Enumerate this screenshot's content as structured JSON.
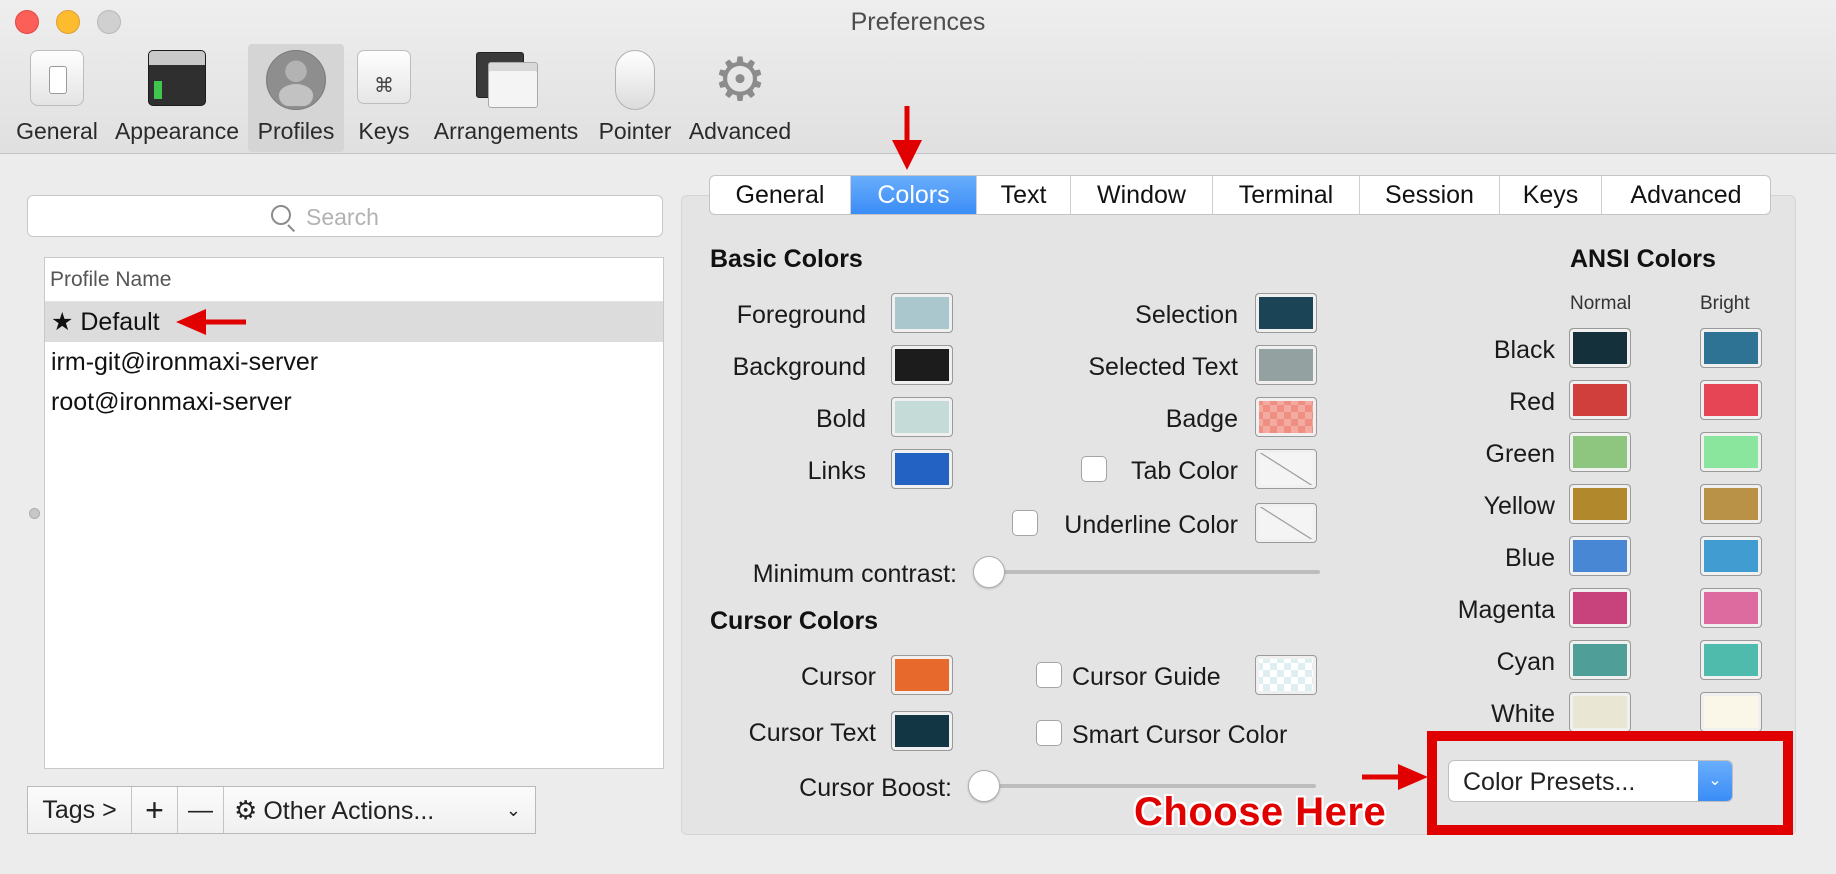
{
  "window": {
    "title": "Preferences"
  },
  "toolbar": {
    "items": [
      {
        "label": "General",
        "icon": "general-switch-icon"
      },
      {
        "label": "Appearance",
        "icon": "appearance-terminal-icon"
      },
      {
        "label": "Profiles",
        "icon": "profiles-user-icon",
        "selected": true
      },
      {
        "label": "Keys",
        "icon": "keys-command-icon"
      },
      {
        "label": "Arrangements",
        "icon": "arrangements-windows-icon"
      },
      {
        "label": "Pointer",
        "icon": "pointer-mouse-icon"
      },
      {
        "label": "Advanced",
        "icon": "advanced-gear-icon"
      }
    ],
    "keys_glyph": "⌘",
    "gear_glyph": "⚙"
  },
  "profiles": {
    "search_placeholder": "Search",
    "header": "Profile Name",
    "items": [
      {
        "name": "★ Default",
        "selected": true
      },
      {
        "name": "irm-git@ironmaxi-server"
      },
      {
        "name": "root@ironmaxi-server"
      }
    ],
    "tags_label": "Tags >",
    "add_label": "+",
    "remove_label": "—",
    "other_actions_label": "Other Actions...",
    "chevron": "⌄"
  },
  "tabs": [
    {
      "label": "General"
    },
    {
      "label": "Colors",
      "active": true
    },
    {
      "label": "Text"
    },
    {
      "label": "Window"
    },
    {
      "label": "Terminal"
    },
    {
      "label": "Session"
    },
    {
      "label": "Keys"
    },
    {
      "label": "Advanced"
    }
  ],
  "basic_colors": {
    "title": "Basic Colors",
    "foreground": {
      "label": "Foreground",
      "color": "#a9c7cc"
    },
    "background": {
      "label": "Background",
      "color": "#1c1c1c"
    },
    "bold": {
      "label": "Bold",
      "color": "#c4dbd8"
    },
    "links": {
      "label": "Links",
      "color": "#2362c3"
    },
    "selection": {
      "label": "Selection",
      "color": "#1b4556"
    },
    "selected_text": {
      "label": "Selected Text",
      "color": "#93a1a1"
    },
    "badge": {
      "label": "Badge",
      "color": "#ef8f82"
    },
    "tab_color": {
      "label": "Tab Color",
      "checked": false
    },
    "underline_color": {
      "label": "Underline Color",
      "checked": false
    },
    "min_contrast_label": "Minimum contrast:"
  },
  "cursor_colors": {
    "title": "Cursor Colors",
    "cursor": {
      "label": "Cursor",
      "color": "#e7692b"
    },
    "cursor_text": {
      "label": "Cursor Text",
      "color": "#123643"
    },
    "cursor_guide": {
      "label": "Cursor Guide",
      "checked": false
    },
    "smart_cursor": {
      "label": "Smart Cursor Color",
      "checked": false
    },
    "cursor_boost_label": "Cursor Boost:"
  },
  "ansi": {
    "title": "ANSI Colors",
    "normal_header": "Normal",
    "bright_header": "Bright",
    "rows": [
      {
        "name": "Black",
        "normal": "#14303b",
        "bright": "#2e7393"
      },
      {
        "name": "Red",
        "normal": "#d03f3b",
        "bright": "#e54555"
      },
      {
        "name": "Green",
        "normal": "#8ec57f",
        "bright": "#89e69c"
      },
      {
        "name": "Yellow",
        "normal": "#b1882c",
        "bright": "#b99147"
      },
      {
        "name": "Blue",
        "normal": "#4787d4",
        "bright": "#419dd1"
      },
      {
        "name": "Magenta",
        "normal": "#c8427c",
        "bright": "#de6ba0"
      },
      {
        "name": "Cyan",
        "normal": "#4f9e97",
        "bright": "#4ebbad"
      },
      {
        "name": "White",
        "normal": "#e9e6d3",
        "bright": "#faf6e8"
      }
    ]
  },
  "color_presets": {
    "label": "Color Presets..."
  },
  "annotations": {
    "callout": "Choose Here",
    "accent": "#e00000"
  }
}
